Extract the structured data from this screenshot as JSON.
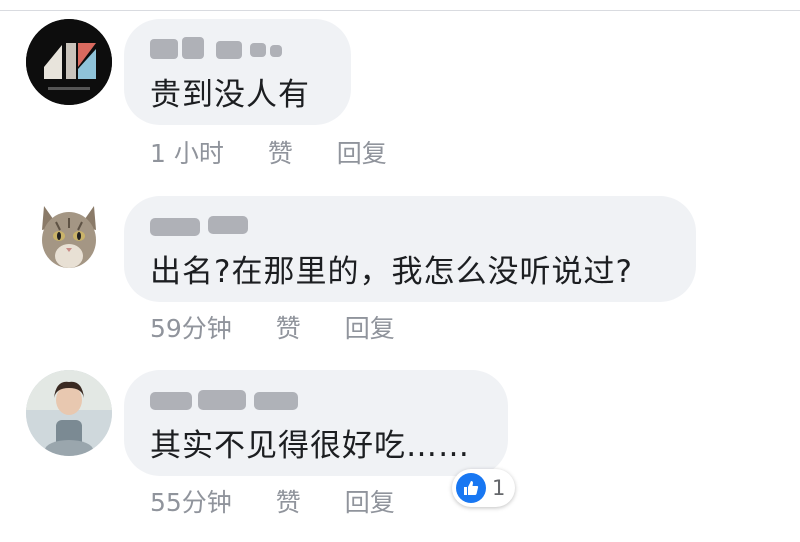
{
  "comments": [
    {
      "text": "贵到没人有",
      "time": "1 小时",
      "like_label": "赞",
      "reply_label": "回复"
    },
    {
      "text": "出名?在那里的，我怎么没听说过?",
      "time": "59分钟",
      "like_label": "赞",
      "reply_label": "回复"
    },
    {
      "text": "其实不见得很好吃……",
      "time": "55分钟",
      "like_label": "赞",
      "reply_label": "回复",
      "reaction_count": "1"
    }
  ],
  "colors": {
    "bubble": "#f0f2f5",
    "meta_text": "#90949c",
    "like_blue": "#1877f2"
  }
}
